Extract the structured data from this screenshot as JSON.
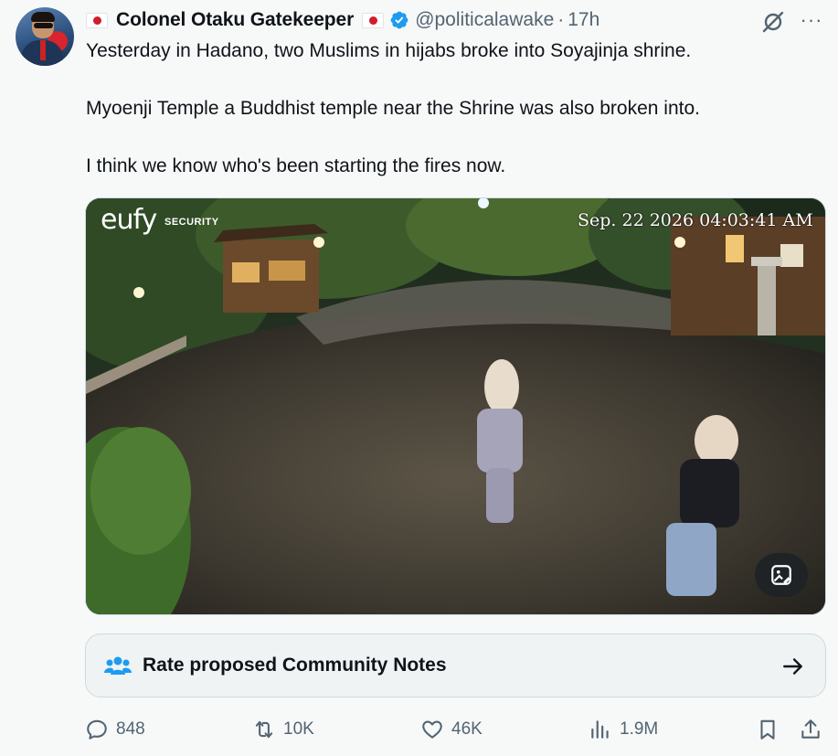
{
  "post": {
    "author_name": "Colonel Otaku Gatekeeper",
    "handle": "@politicalawake",
    "separator": "·",
    "time": "17h",
    "more_label": "···",
    "paragraphs": [
      "Yesterday in Hadano, two Muslims in hijabs broke into Soyajinja shrine.",
      "Myoenji Temple a Buddhist temple near the Shrine was also broken into.",
      "I think we know who's been starting the fires now."
    ]
  },
  "media": {
    "brand": "eufy",
    "brand_sub": "SECURITY",
    "timestamp": "Sep. 22  2026  04:03:41  AM"
  },
  "community_notes": {
    "label": "Rate proposed Community Notes"
  },
  "actions": {
    "replies": "848",
    "reposts": "10K",
    "likes": "46K",
    "views": "1.9M"
  },
  "icons": {
    "verified": "verified-badge-icon",
    "grok": "grok-icon",
    "more": "more-icon",
    "alt": "image-alt-icon",
    "notes": "community-notes-icon",
    "arrow": "arrow-right-icon",
    "reply": "reply-icon",
    "repost": "repost-icon",
    "like": "like-icon",
    "views": "views-icon",
    "bookmark": "bookmark-icon",
    "share": "share-icon"
  },
  "colors": {
    "accent": "#1d9bf0",
    "text": "#0f1419",
    "secondary": "#536471",
    "background": "#f7f9f9"
  }
}
